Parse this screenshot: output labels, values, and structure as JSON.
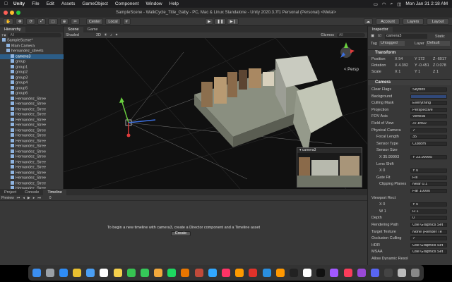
{
  "menubar": {
    "items": [
      "Unity",
      "File",
      "Edit",
      "Assets",
      "GameObject",
      "Component",
      "Window",
      "Help"
    ],
    "clock": "Mon Jan 31  2:18 AM"
  },
  "window": {
    "title": "SampleScene - WalkCycle_Title_Gaby - PC, Mac & Linux Standalone - Unity 2020.3.7f1 Personal (Personal) <Metal>"
  },
  "toolbar": {
    "pivot": "Center",
    "space": "Local",
    "account": "Account",
    "layers": "Layers",
    "layout": "Layout"
  },
  "hierarchy": {
    "tab": "Hierarchy",
    "search_placeholder": "All",
    "items": [
      {
        "label": "SampleScene*",
        "indent": 0
      },
      {
        "label": "Main Camera",
        "indent": 1
      },
      {
        "label": "hernandez_streets",
        "indent": 1
      },
      {
        "label": "camera3",
        "indent": 2
      },
      {
        "label": "group",
        "indent": 2
      },
      {
        "label": "group1",
        "indent": 2
      },
      {
        "label": "group2",
        "indent": 2
      },
      {
        "label": "group3",
        "indent": 2
      },
      {
        "label": "group4",
        "indent": 2
      },
      {
        "label": "group5",
        "indent": 2
      },
      {
        "label": "group6",
        "indent": 2
      },
      {
        "label": "Hernandez_Stree",
        "indent": 2
      },
      {
        "label": "Hernandez_Stree",
        "indent": 2
      },
      {
        "label": "Hernandez_Stree",
        "indent": 2
      },
      {
        "label": "Hernandez_Stree",
        "indent": 2
      },
      {
        "label": "Hernandez_Stree",
        "indent": 2
      },
      {
        "label": "Hernandez_Stree",
        "indent": 2
      },
      {
        "label": "Hernandez_Stree",
        "indent": 2
      },
      {
        "label": "Hernandez_Stree",
        "indent": 2
      },
      {
        "label": "Hernandez_Stree",
        "indent": 2
      },
      {
        "label": "Hernandez_Stree",
        "indent": 2
      },
      {
        "label": "Hernandez_Stree",
        "indent": 2
      },
      {
        "label": "Hernandez_Stree",
        "indent": 2
      },
      {
        "label": "Hernandez_Stree",
        "indent": 2
      },
      {
        "label": "Hernandez_Stree",
        "indent": 2
      },
      {
        "label": "Hernandez_Stree",
        "indent": 2
      },
      {
        "label": "Hernandez_Stree",
        "indent": 2
      },
      {
        "label": "Hernandez_Stree",
        "indent": 2
      },
      {
        "label": "Hernandez_Stree",
        "indent": 2
      },
      {
        "label": "Hernandez_Stree",
        "indent": 2
      },
      {
        "label": "Hernandez_Stree",
        "indent": 2
      },
      {
        "label": "Hernandez_Stree",
        "indent": 2
      }
    ]
  },
  "scene": {
    "tabs": [
      "Scene",
      "Game"
    ],
    "shading": "Shaded",
    "mode_2d": "2D",
    "gizmos": "Gizmos",
    "search_placeholder": "All",
    "persp": "< Persp",
    "preview_title": "camera3"
  },
  "bottom": {
    "tabs": [
      "Project",
      "Console",
      "Timeline"
    ],
    "preview": "Preview",
    "frame": "0",
    "message": "To begin a new timeline with camera3, create a Director component and a Timeline asset",
    "create_button": "Create"
  },
  "inspector": {
    "tab": "Inspector",
    "object_name": "camera3",
    "static": "Static",
    "tag_label": "Tag",
    "tag": "Untagged",
    "layer_label": "Layer",
    "layer": "Default",
    "transform_title": "Transform",
    "position": {
      "label": "Position",
      "x": "X  54",
      "y": "Y  172",
      "z": "Z  -6017"
    },
    "rotation": {
      "label": "Rotation",
      "x": "X  4.392",
      "y": "Y  -0.451",
      "z": "Z  0.078"
    },
    "scale": {
      "label": "Scale",
      "x": "X  1",
      "y": "Y  1",
      "z": "Z  1"
    },
    "camera_title": "Camera",
    "rows": [
      {
        "label": "Clear Flags",
        "value": "Skybox"
      },
      {
        "label": "Background",
        "value": ""
      },
      {
        "label": "Culling Mask",
        "value": "Everything"
      },
      {
        "label": "Projection",
        "value": "Perspective"
      },
      {
        "label": "FOV Axis",
        "value": "Vertical"
      },
      {
        "label": "Field of View",
        "value": "37.8492"
      },
      {
        "label": "Physical Camera",
        "value": "✓"
      },
      {
        "label": "Focal Length",
        "value": "35"
      },
      {
        "label": "Sensor Type",
        "value": "Custom"
      },
      {
        "label": "Sensor Size",
        "value": ""
      },
      {
        "label": "X  35.99993",
        "value": "Y  23.99995"
      },
      {
        "label": "Lens Shift",
        "value": ""
      },
      {
        "label": "X  0",
        "value": "Y  0"
      },
      {
        "label": "Gate Fit",
        "value": "Fill"
      },
      {
        "label": "Clipping Planes",
        "value": "Near  0.1"
      },
      {
        "label": "",
        "value": "Far   10000"
      },
      {
        "label": "Viewport Rect",
        "value": ""
      },
      {
        "label": "X  0",
        "value": "Y  0"
      },
      {
        "label": "W  1",
        "value": "H  1"
      },
      {
        "label": "Depth",
        "value": "0"
      },
      {
        "label": "Rendering Path",
        "value": "Use Graphics Set"
      },
      {
        "label": "Target Texture",
        "value": "None (Render Te"
      },
      {
        "label": "Occlusion Culling",
        "value": "✓"
      },
      {
        "label": "HDR",
        "value": "Use Graphics Set"
      },
      {
        "label": "MSAA",
        "value": "Use Graphics Set"
      },
      {
        "label": "Allow Dynamic Resol",
        "value": ""
      }
    ]
  },
  "colors": {
    "accent": "#3c6ea6",
    "background_swatch": "#31497a",
    "scene_bg": "#101010"
  },
  "dock": {
    "icons": [
      "finder-icon",
      "launchpad-icon",
      "safari-icon",
      "chrome-icon",
      "mail-icon",
      "calendar-icon",
      "notes-icon",
      "facetime-icon",
      "messages-icon",
      "photos-icon",
      "spotify-icon",
      "blender-icon",
      "davinci-icon",
      "photoshop-icon",
      "indesign-icon",
      "illustrator-icon",
      "acrobat-icon",
      "vscode-icon",
      "sublime-icon",
      "unity-icon",
      "notion-icon",
      "capcut-icon",
      "figma-icon",
      "music-icon",
      "podcasts-icon",
      "discord-icon",
      "unityhub-icon",
      "preview-icon",
      "trash-icon"
    ]
  }
}
